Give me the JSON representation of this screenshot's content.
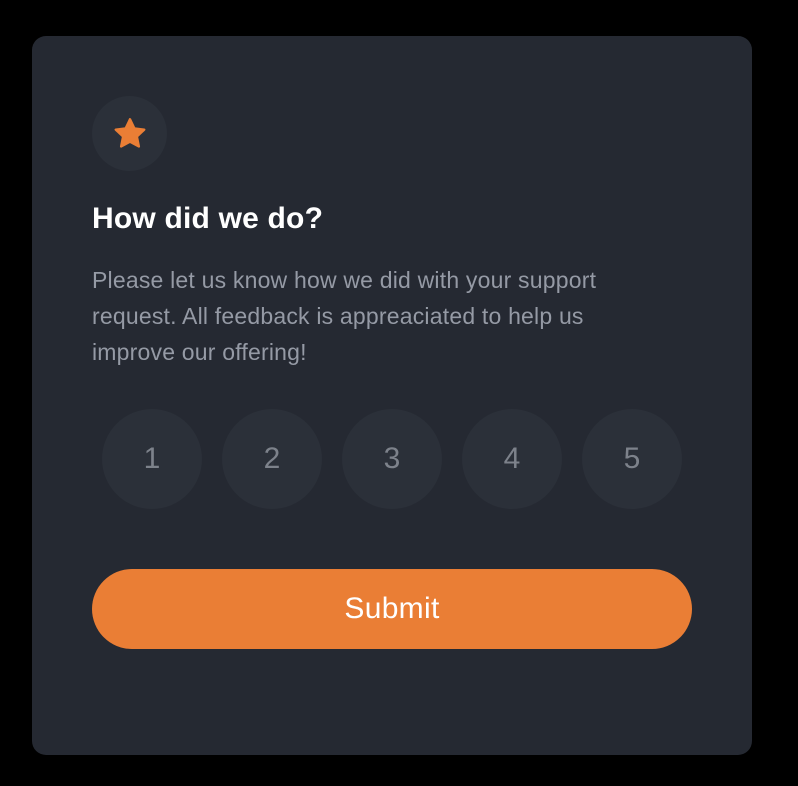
{
  "card": {
    "icon": "star-icon",
    "accent_color": "#ea7e35",
    "background_color": "#252932",
    "title": "How did we do?",
    "description": "Please let us know how we did with your support request. All feedback is appreaciated to help us improve our offering!",
    "ratings": [
      "1",
      "2",
      "3",
      "4",
      "5"
    ],
    "submit_label": "Submit"
  }
}
